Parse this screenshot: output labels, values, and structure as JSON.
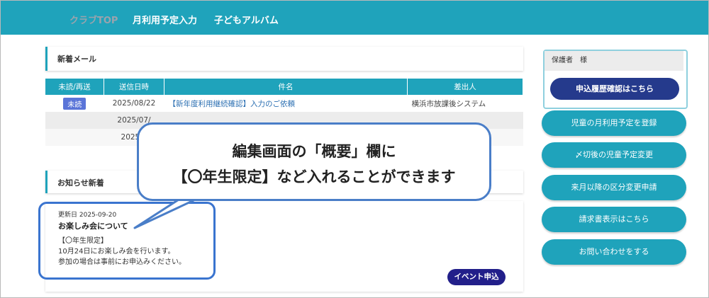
{
  "nav": {
    "club_top": "クラブTOP",
    "monthly_input": "月利用予定入力",
    "kids_album": "子どもアルバム"
  },
  "mail": {
    "title": "新着メール",
    "headers": [
      "未読/再送",
      "送信日時",
      "件名",
      "差出人"
    ],
    "rows": [
      {
        "status": "未読",
        "date": "2025/08/22",
        "subject": "【新年度利用継続確認】入力のご依頼",
        "sender": "横浜市放課後システム"
      },
      {
        "status": "",
        "date": "2025/07/",
        "subject": "",
        "sender": ""
      },
      {
        "status": "",
        "date": "2025/0",
        "subject": "",
        "sender": ""
      }
    ]
  },
  "notice": {
    "title": "お知らせ新着",
    "meta": "更新日 2025-09-20",
    "item_title": "お楽しみ会について",
    "lines": [
      "【〇年生限定】",
      "10月24日にお楽しみ会を行います。",
      "参加の場合は事前にお申込みください。"
    ],
    "event_button": "イベント申込"
  },
  "callout": {
    "line1": "編集画面の「概要」欄に",
    "line2": "【〇年生限定】など入れることができます"
  },
  "sidebar": {
    "guardian": "保護者　様",
    "history_button": "申込履歴確認はこちら",
    "buttons": [
      "児童の月利用予定を登録",
      "〆切後の児童予定変更",
      "来月以降の区分変更申請",
      "請求書表示はこちら",
      "お問い合わせをする"
    ]
  },
  "colors": {
    "teal": "#1fa3bb",
    "navy": "#253a8c",
    "event_navy": "#221f8a",
    "unread_badge": "#5a74d8",
    "highlight_blue": "#3a74cf"
  }
}
